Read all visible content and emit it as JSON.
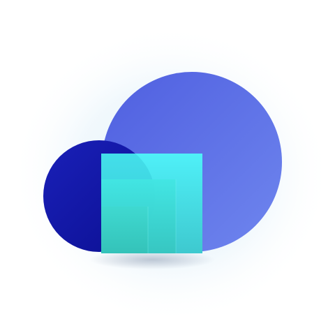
{
  "logo": {
    "icon_name": "cloud-stacked-squares-logo",
    "colors": {
      "glow": "#e8f4fb",
      "large_circle_light": "#6f86ee",
      "large_circle_dark": "#4f5fe0",
      "small_circle_light": "#1a20b8",
      "small_circle_dark": "#0b0f92",
      "square_outer_top": "#4ff0f8",
      "square_outer_bottom": "#3ec9cf",
      "square_mid_top": "#42e6e3",
      "square_mid_bottom": "#36c6c0",
      "square_inner_top": "#3fd9d0",
      "square_inner_bottom": "#34c2b8",
      "shadow": "#5a6a8a"
    }
  }
}
